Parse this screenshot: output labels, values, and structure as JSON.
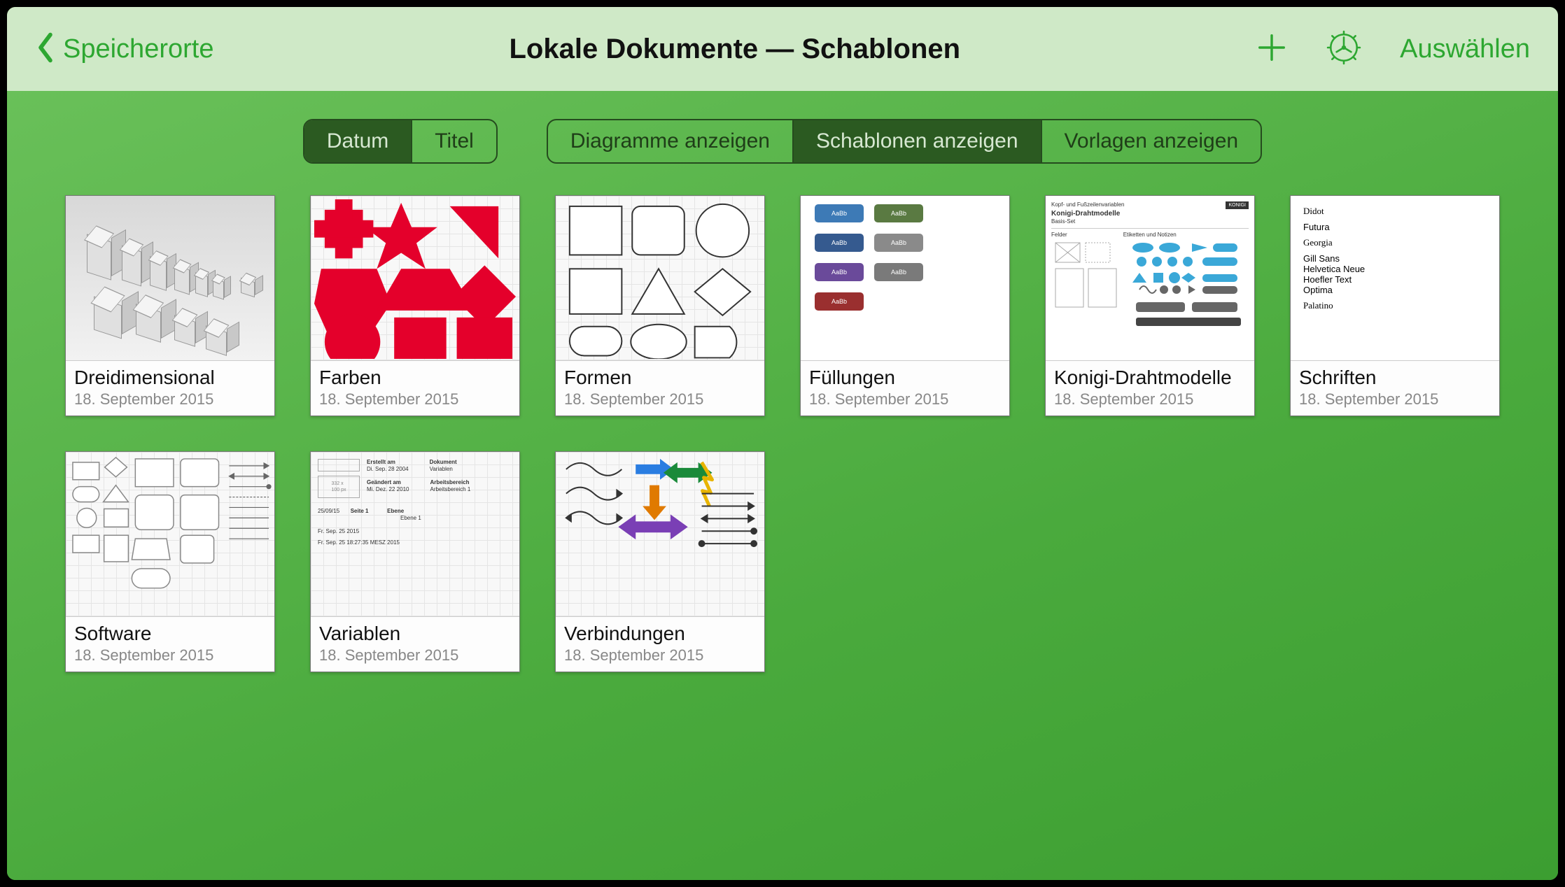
{
  "header": {
    "back_label": "Speicherorte",
    "title": "Lokale Dokumente — Schablonen",
    "select_label": "Auswählen"
  },
  "sort_segment": {
    "items": [
      {
        "label": "Datum",
        "active": true
      },
      {
        "label": "Titel",
        "active": false
      }
    ]
  },
  "filter_segment": {
    "items": [
      {
        "label": "Diagramme anzeigen",
        "active": false
      },
      {
        "label": "Schablonen anzeigen",
        "active": true
      },
      {
        "label": "Vorlagen anzeigen",
        "active": false
      }
    ]
  },
  "documents": [
    {
      "title": "Dreidimensional",
      "date": "18. September 2015",
      "kind": "3d"
    },
    {
      "title": "Farben",
      "date": "18. September 2015",
      "kind": "colors"
    },
    {
      "title": "Formen",
      "date": "18. September 2015",
      "kind": "shapes"
    },
    {
      "title": "Füllungen",
      "date": "18. September 2015",
      "kind": "fills"
    },
    {
      "title": "Konigi-Drahtmodelle",
      "date": "18. September 2015",
      "kind": "konigi"
    },
    {
      "title": "Schriften",
      "date": "18. September 2015",
      "kind": "fonts"
    },
    {
      "title": "Software",
      "date": "18. September 2015",
      "kind": "software"
    },
    {
      "title": "Variablen",
      "date": "18. September 2015",
      "kind": "variables"
    },
    {
      "title": "Verbindungen",
      "date": "18. September 2015",
      "kind": "connections"
    }
  ],
  "fills_labels": {
    "sample": "AaBb"
  },
  "konigi_text": {
    "line1": "Kopf- und Fußzeilenvariablen",
    "line2": "Konigi-Drahtmodelle",
    "line3": "Basis-Set",
    "badge": "KONIGI",
    "col1": "Felder",
    "col2": "Etiketten und Notizen"
  },
  "fonts_list": [
    "Didot",
    "Futura",
    "Georgia",
    "Gill Sans",
    "Helvetica Neue",
    "Hoefler Text",
    "Optima",
    "Palatino"
  ],
  "variables_text": {
    "c1a": "Erstellt am",
    "c1b": "Di. Sep. 28 2004",
    "c2a": "Dokument",
    "c2b": "Variablen",
    "c3a": "Geändert am",
    "c3b": "Mi. Dez. 22 2010",
    "c4a": "Arbeitsbereich",
    "c4b": "Arbeitsbereich 1",
    "c5a": "25/09/15",
    "c5b": "Seite 1",
    "c6a": "Ebene",
    "c6b": "Ebene 1",
    "c7": "Fr. Sep. 25 2015",
    "c8": "Fr. Sep. 25 18:27:35 MESZ 2015"
  }
}
